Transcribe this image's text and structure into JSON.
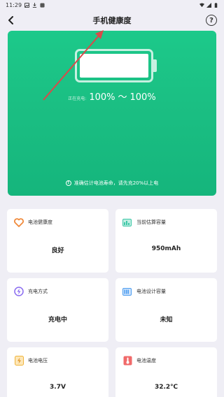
{
  "status_bar": {
    "time": "11:29"
  },
  "header": {
    "title": "手机健康度",
    "help_label": "?"
  },
  "hero": {
    "battery_level": 1.0,
    "charging_label": "正在充电:",
    "charge_from": "100%",
    "charge_tilde": "～",
    "charge_to": "100%",
    "note": "准确估计电池寿命，请先充20%以上电",
    "info_mark": "!"
  },
  "cards": [
    {
      "title": "电池健康度",
      "value": "良好",
      "icon": "heart-icon",
      "color": "#f08a3c"
    },
    {
      "title": "当前估算容量",
      "value": "950mAh",
      "icon": "battery-capacity-icon",
      "color": "#3cc7a6"
    },
    {
      "title": "充电方式",
      "value": "充电中",
      "icon": "lightning-icon",
      "color": "#8a6cf0"
    },
    {
      "title": "电池设计容量",
      "value": "未知",
      "icon": "battery-design-icon",
      "color": "#4a9cf0"
    },
    {
      "title": "电池电压",
      "value": "3.7V",
      "icon": "voltage-icon",
      "color": "#f0b43c"
    },
    {
      "title": "电池温度",
      "value": "32.2℃",
      "icon": "thermometer-icon",
      "color": "#f06a6a"
    }
  ],
  "colors": {
    "hero_green": "#1cc98a",
    "background": "#efeef5",
    "arrow": "#d94a4a"
  }
}
